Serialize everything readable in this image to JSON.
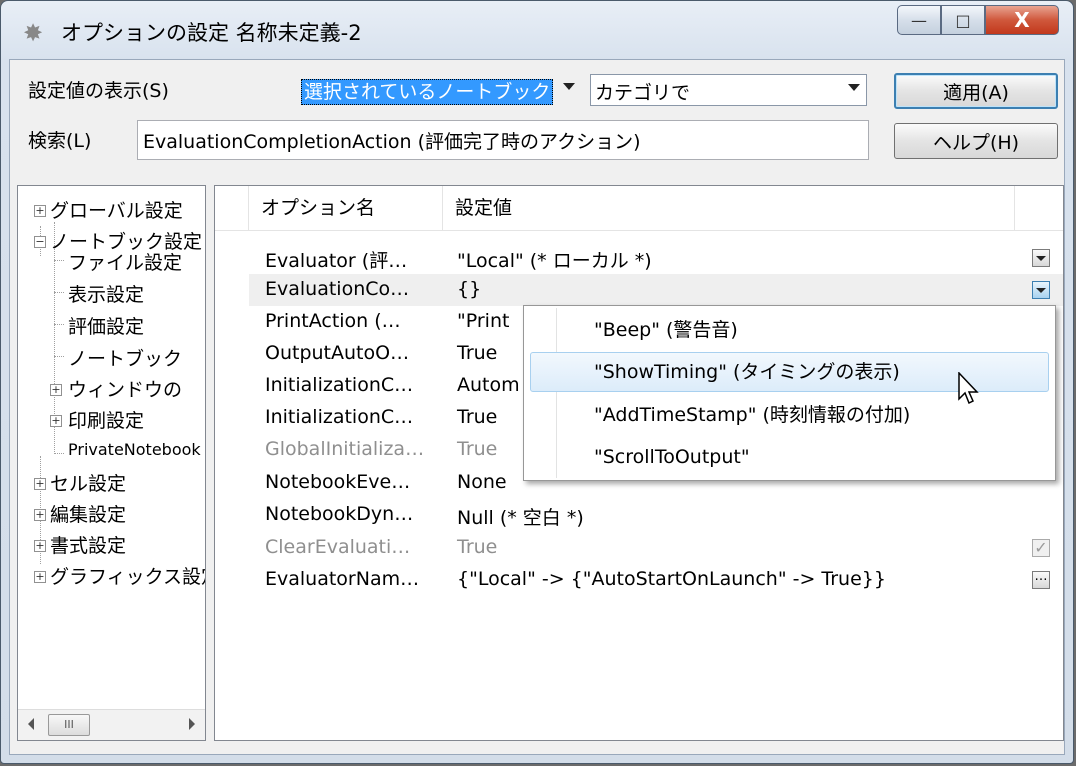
{
  "window": {
    "title": "オプションの設定 名称未定義-2",
    "controls": {
      "minimize": "—",
      "maximize": "□",
      "close": "X"
    }
  },
  "toolbar": {
    "display_label": "設定値の表示(S)",
    "scope_value": "選択されているノートブック",
    "category_value": "カテゴリで",
    "apply_label": "適用(A)",
    "search_label": "検索(L)",
    "search_value": "EvaluationCompletionAction (評価完了時のアクション)",
    "help_label": "ヘルプ(H)"
  },
  "tree": {
    "items": [
      {
        "label": "グローバル設定",
        "expander": "+"
      },
      {
        "label": "ノートブック設定",
        "expander": "−"
      },
      {
        "label": "ファイル設定"
      },
      {
        "label": "表示設定"
      },
      {
        "label": "評価設定"
      },
      {
        "label": "ノートブック"
      },
      {
        "label": "ウィンドウの",
        "expander": "+"
      },
      {
        "label": "印刷設定",
        "expander": "+"
      },
      {
        "label": "PrivateNotebook"
      },
      {
        "label": "セル設定",
        "expander": "+"
      },
      {
        "label": "編集設定",
        "expander": "+"
      },
      {
        "label": "書式設定",
        "expander": "+"
      },
      {
        "label": "グラフィックス設定",
        "expander": "+"
      }
    ],
    "scroll_thumb": "III"
  },
  "grid": {
    "columns": [
      "オプション名",
      "設定値"
    ],
    "rows": [
      {
        "name": "Evaluator (評…",
        "value": "\"Local\" (* ローカル *)"
      },
      {
        "name": "EvaluationCo…",
        "value": "{}"
      },
      {
        "name": "PrintAction (…",
        "value": "\"Print"
      },
      {
        "name": "OutputAutoO…",
        "value": "True"
      },
      {
        "name": "InitializationC…",
        "value": "Autom"
      },
      {
        "name": "InitializationC…",
        "value": "True"
      },
      {
        "name": "GlobalInitializa…",
        "value": "True"
      },
      {
        "name": "NotebookEve…",
        "value": "None"
      },
      {
        "name": "NotebookDyn…",
        "value": "Null (* 空白 *)"
      },
      {
        "name": "ClearEvaluati…",
        "value": "True"
      },
      {
        "name": "EvaluatorNam…",
        "value": "{\"Local\" -> {\"AutoStartOnLaunch\" -> True}}"
      }
    ]
  },
  "popup": {
    "items": [
      "\"Beep\" (警告音)",
      "\"ShowTiming\" (タイミングの表示)",
      "\"AddTimeStamp\" (時刻情報の付加)",
      "\"ScrollToOutput\""
    ]
  }
}
